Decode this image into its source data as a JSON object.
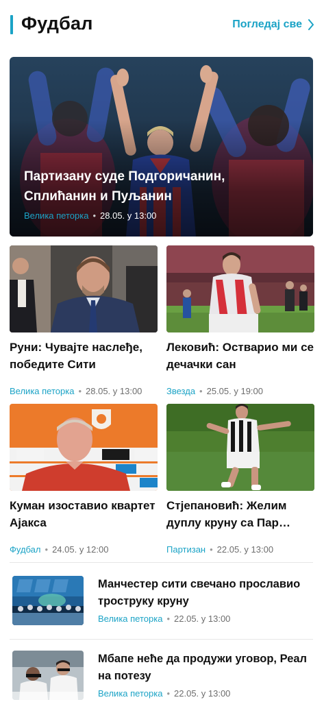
{
  "header": {
    "title": "Фудбал",
    "see_all_label": "Погледај све"
  },
  "colors": {
    "accent": "#1ba3c6",
    "text": "#111111",
    "meta": "#6d6d6d"
  },
  "hero": {
    "title": "Партизану суде Подгоричанин, Сплићанин и Пуљанин",
    "category": "Велика петорка",
    "date": "28.05. у 13:00"
  },
  "cards": [
    {
      "title": "Руни: Чувајте наслеђе, победите Сити",
      "category": "Велика петорка",
      "date": "28.05. у 13:00"
    },
    {
      "title": "Лековић: Остварио ми се дечачки сан",
      "category": "Звезда",
      "date": "25.05. у 19:00"
    },
    {
      "title": "Куман изоставио квартет Ајакса",
      "category": "Фудбал",
      "date": "24.05. у 12:00"
    },
    {
      "title": "Стјепановић: Желим дуплу круну са Пар…",
      "category": "Партизан",
      "date": "22.05. у 13:00"
    }
  ],
  "list": [
    {
      "title": "Манчестер сити свечано прославио троструку круну",
      "category": "Велика петорка",
      "date": "22.05. у 13:00"
    },
    {
      "title": "Мбапе неће да продужи уговор, Реал на потезу",
      "category": "Велика петорка",
      "date": "22.05. у 13:00"
    }
  ],
  "separator": "•"
}
